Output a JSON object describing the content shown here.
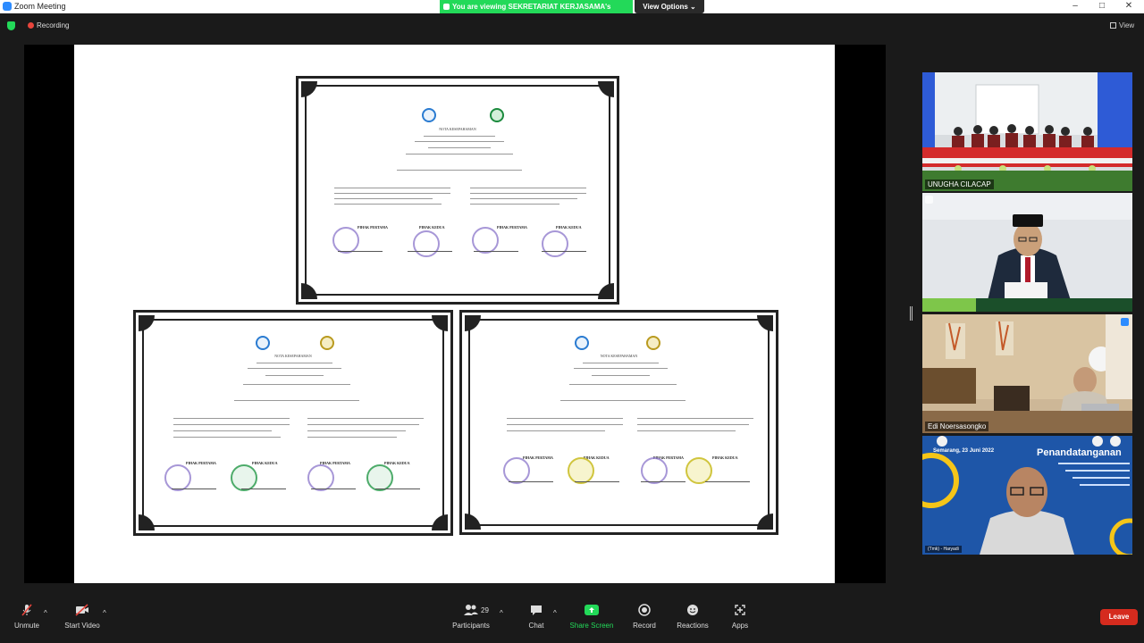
{
  "window": {
    "title": "Zoom Meeting"
  },
  "share_banner": {
    "text": "You are viewing SEKRETARIAT KERJASAMA's screen",
    "view_options": "View Options"
  },
  "status": {
    "recording_label": "Recording",
    "view_label": "View"
  },
  "shared_slide": {
    "certificate_title": "NOTA KESEPAHAMAN",
    "party_first": "PIHAK PERTAMA",
    "party_second": "PIHAK KEDUA"
  },
  "participants": [
    {
      "name": "UNUGHA CILACAP"
    },
    {
      "name": ""
    },
    {
      "name": "Edi Noersasongko"
    },
    {
      "name": "(Tmk) - Haryadi"
    }
  ],
  "tile4_overlay": {
    "city_date": "Semarang, 23 Juni 2022",
    "heading": "Penandatanganan"
  },
  "toolbar": {
    "unmute": "Unmute",
    "start_video": "Start Video",
    "participants": "Participants",
    "participants_count": "29",
    "chat": "Chat",
    "share_screen": "Share Screen",
    "record": "Record",
    "reactions": "Reactions",
    "apps": "Apps",
    "leave": "Leave"
  },
  "colors": {
    "share_green": "#23d959",
    "leave_red": "#d52b1e",
    "zoom_blue": "#2d8cff"
  }
}
